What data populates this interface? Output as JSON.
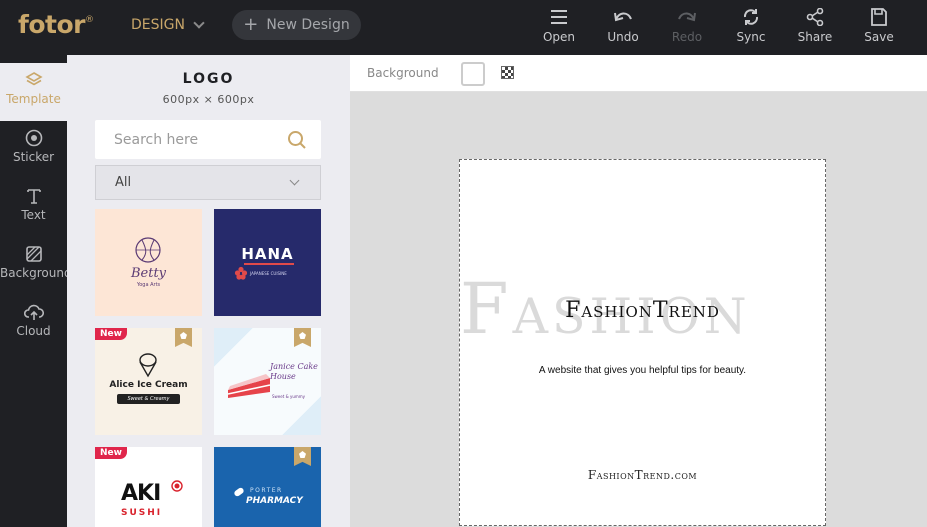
{
  "app": {
    "logo": "fotor",
    "logo_mark": "®"
  },
  "header": {
    "design_label": "DESIGN",
    "new_design_label": "New Design",
    "tools": [
      {
        "label": "Open",
        "icon": "menu-icon"
      },
      {
        "label": "Undo",
        "icon": "undo-icon"
      },
      {
        "label": "Redo",
        "icon": "redo-icon",
        "disabled": true
      },
      {
        "label": "Sync",
        "icon": "sync-icon"
      },
      {
        "label": "Share",
        "icon": "share-icon"
      },
      {
        "label": "Save",
        "icon": "save-icon"
      }
    ]
  },
  "sidebar": {
    "items": [
      {
        "label": "Template",
        "icon": "layers-icon",
        "active": true
      },
      {
        "label": "Sticker",
        "icon": "sticker-icon"
      },
      {
        "label": "Text",
        "icon": "text-icon"
      },
      {
        "label": "Background",
        "icon": "background-icon"
      },
      {
        "label": "Cloud",
        "icon": "cloud-upload-icon"
      }
    ]
  },
  "panel": {
    "title": "LOGO",
    "subtitle": "600px × 600px",
    "search_placeholder": "Search here",
    "filter_value": "All",
    "templates": [
      {
        "name": "Betty",
        "caption": "Yoga Arts",
        "bg": "#fde6d6"
      },
      {
        "name": "HANA",
        "caption": "JAPANESE CUISINE",
        "bg": "#262a6b"
      },
      {
        "name": "Alice Ice Cream",
        "caption": "Sweet & Creamy",
        "badge": "New",
        "premium": true,
        "bg": "#f8f1e6"
      },
      {
        "name": "Janice Cake House",
        "caption": "Sweet & yummy",
        "premium": true,
        "bg": "#eef6fb"
      },
      {
        "name": "AKI",
        "caption": "SUSHI",
        "badge": "New",
        "bg": "#ffffff"
      },
      {
        "name": "PORTER",
        "caption": "PHARMACY",
        "premium": true,
        "bg": "#1a64ad"
      }
    ]
  },
  "canvas": {
    "background_label": "Background",
    "background_word": "Fashion",
    "headline": "FashionTrend",
    "tagline": "A website that gives you helpful tips for beauty.",
    "site": "FashionTrend.com"
  },
  "colors": {
    "accent": "#c9a76a",
    "topbar": "#1f2024",
    "new_badge": "#e0264b"
  }
}
